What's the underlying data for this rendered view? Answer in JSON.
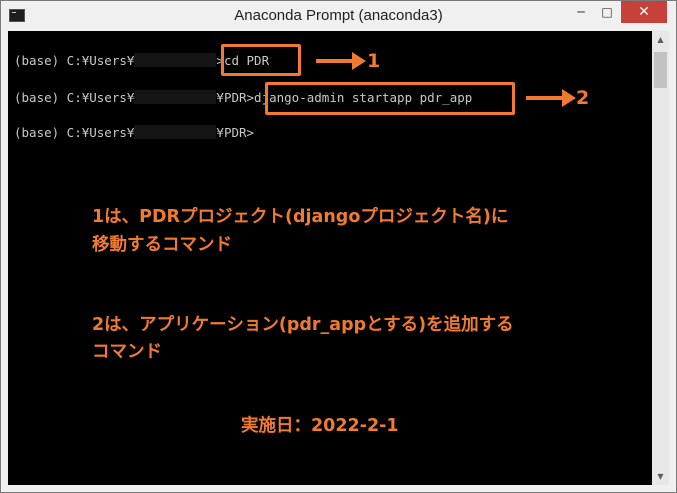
{
  "window": {
    "title": "Anaconda Prompt (anaconda3)",
    "minimize_glyph": "─",
    "maximize_glyph": "□",
    "close_glyph": "✕",
    "icon": "terminal-icon"
  },
  "terminal": {
    "lines": [
      {
        "prompt": "(base) C:¥Users¥",
        "suffix": "",
        "input": ">cd PDR"
      },
      {
        "prompt": "(base) C:¥Users¥",
        "suffix": "¥PDR",
        "input": ">django-admin startapp pdr_app"
      },
      {
        "prompt": "(base) C:¥Users¥",
        "suffix": "¥PDR",
        "input": ">"
      }
    ]
  },
  "annotations": {
    "marker1": "1",
    "marker2": "2",
    "note1_line1": "1は、PDRプロジェクト(djangoプロジェクト名)に",
    "note1_line2": "移動するコマンド",
    "note2_line1": "2は、アプリケーション(pdr_appとする)を追加する",
    "note2_line2": "コマンド",
    "date": "実施日：2022-2-1"
  },
  "scrollbar": {
    "up_glyph": "▲",
    "down_glyph": "▼"
  },
  "colors": {
    "accent": "#f07a30",
    "terminal_bg": "#000000",
    "terminal_fg": "#c8c8c8",
    "close_button": "#c7403a"
  }
}
